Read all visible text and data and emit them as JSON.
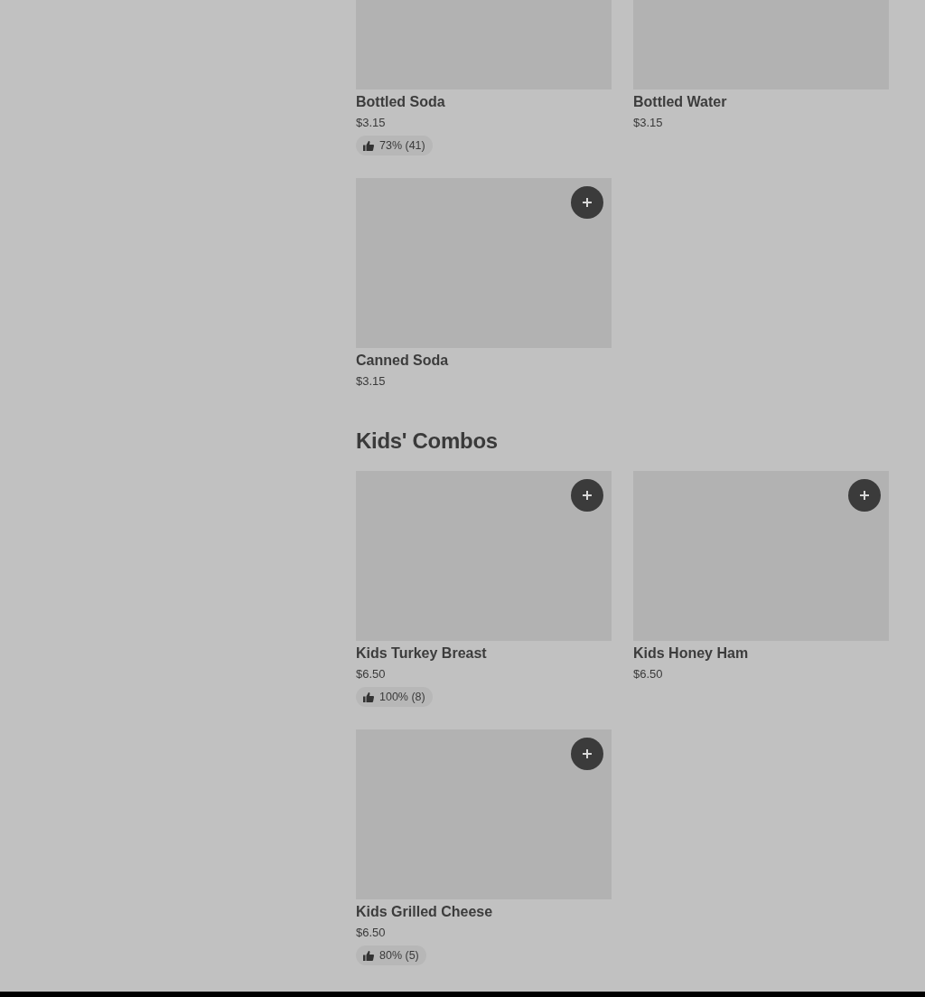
{
  "sections": [
    {
      "cut_top": true,
      "items": [
        {
          "name": "Bottled Soda",
          "price": "$3.15",
          "rating": "73% (41)"
        },
        {
          "name": "Bottled Water",
          "price": "$3.15"
        },
        {
          "name": "Canned Soda",
          "price": "$3.15"
        }
      ]
    },
    {
      "title": "Kids' Combos",
      "cut_top": false,
      "items": [
        {
          "name": "Kids Turkey Breast",
          "price": "$6.50",
          "rating": "100% (8)"
        },
        {
          "name": "Kids Honey Ham",
          "price": "$6.50"
        },
        {
          "name": "Kids Grilled Cheese",
          "price": "$6.50",
          "rating": "80% (5)"
        }
      ]
    }
  ]
}
